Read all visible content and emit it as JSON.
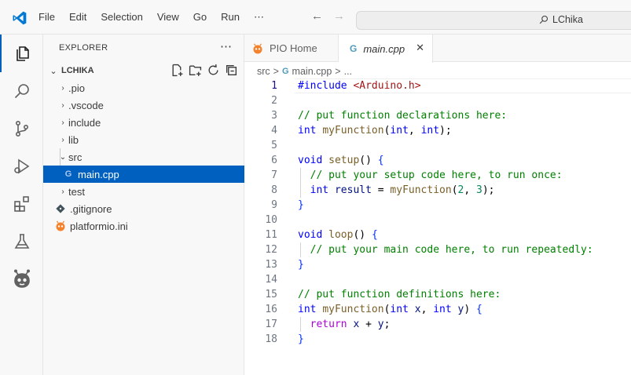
{
  "titlebar": {
    "menu": [
      "File",
      "Edit",
      "Selection",
      "View",
      "Go",
      "Run",
      "⋯"
    ],
    "search_text": "LChika"
  },
  "activity_bar": {
    "items": [
      "explorer-icon",
      "search-icon",
      "source-control-icon",
      "run-debug-icon",
      "extensions-icon",
      "testing-icon",
      "platformio-icon"
    ],
    "active": "explorer-icon"
  },
  "sidebar": {
    "header": "EXPLORER",
    "more": "⋯",
    "section_title": "LCHIKA",
    "tree": [
      {
        "label": ".pio",
        "type": "folder",
        "expanded": false
      },
      {
        "label": ".vscode",
        "type": "folder",
        "expanded": false
      },
      {
        "label": "include",
        "type": "folder",
        "expanded": false
      },
      {
        "label": "lib",
        "type": "folder",
        "expanded": false
      },
      {
        "label": "src",
        "type": "folder",
        "expanded": true
      },
      {
        "label": "main.cpp",
        "type": "cpp-file",
        "selected": true
      },
      {
        "label": "test",
        "type": "folder",
        "expanded": false
      },
      {
        "label": ".gitignore",
        "type": "git-file"
      },
      {
        "label": "platformio.ini",
        "type": "platformio-file"
      }
    ]
  },
  "tabs": [
    {
      "label": "PIO Home",
      "active": false
    },
    {
      "label": "main.cpp",
      "active": true,
      "close": "✕"
    }
  ],
  "breadcrumb": {
    "folder": "src",
    "sep": ">",
    "file": "main.cpp",
    "rest": "..."
  },
  "editor": {
    "current_line": 1,
    "lines": [
      {
        "n": "1",
        "tokens": [
          [
            "#include",
            "kw"
          ],
          [
            " ",
            "txt"
          ],
          [
            "<Arduino.h>",
            "str"
          ]
        ]
      },
      {
        "n": "2",
        "tokens": []
      },
      {
        "n": "3",
        "tokens": [
          [
            "// put function declarations here:",
            "cm"
          ]
        ]
      },
      {
        "n": "4",
        "tokens": [
          [
            "int",
            "kw"
          ],
          [
            " ",
            "txt"
          ],
          [
            "myFunction",
            "fn"
          ],
          [
            "(",
            "txt"
          ],
          [
            "int",
            "kw"
          ],
          [
            ", ",
            "txt"
          ],
          [
            "int",
            "kw"
          ],
          [
            ");",
            "txt"
          ]
        ]
      },
      {
        "n": "5",
        "tokens": []
      },
      {
        "n": "6",
        "tokens": [
          [
            "void",
            "kw"
          ],
          [
            " ",
            "txt"
          ],
          [
            "setup",
            "fn"
          ],
          [
            "()",
            "txt"
          ],
          [
            " ",
            "txt"
          ],
          [
            "{",
            "br1"
          ]
        ]
      },
      {
        "n": "7",
        "tokens": [
          [
            "  ",
            "txt"
          ],
          [
            "// put your setup code here, to run once:",
            "cm"
          ]
        ]
      },
      {
        "n": "8",
        "tokens": [
          [
            "  ",
            "txt"
          ],
          [
            "int",
            "kw"
          ],
          [
            " ",
            "txt"
          ],
          [
            "result",
            "param"
          ],
          [
            " = ",
            "txt"
          ],
          [
            "myFunction",
            "fn"
          ],
          [
            "(",
            "txt"
          ],
          [
            "2",
            "num"
          ],
          [
            ", ",
            "txt"
          ],
          [
            "3",
            "num"
          ],
          [
            ");",
            "txt"
          ]
        ]
      },
      {
        "n": "9",
        "tokens": [
          [
            "}",
            "br1"
          ]
        ]
      },
      {
        "n": "10",
        "tokens": []
      },
      {
        "n": "11",
        "tokens": [
          [
            "void",
            "kw"
          ],
          [
            " ",
            "txt"
          ],
          [
            "loop",
            "fn"
          ],
          [
            "()",
            "txt"
          ],
          [
            " ",
            "txt"
          ],
          [
            "{",
            "br1"
          ]
        ]
      },
      {
        "n": "12",
        "tokens": [
          [
            "  ",
            "txt"
          ],
          [
            "// put your main code here, to run repeatedly:",
            "cm"
          ]
        ]
      },
      {
        "n": "13",
        "tokens": [
          [
            "}",
            "br1"
          ]
        ]
      },
      {
        "n": "14",
        "tokens": []
      },
      {
        "n": "15",
        "tokens": [
          [
            "// put function definitions here:",
            "cm"
          ]
        ]
      },
      {
        "n": "16",
        "tokens": [
          [
            "int",
            "kw"
          ],
          [
            " ",
            "txt"
          ],
          [
            "myFunction",
            "fn"
          ],
          [
            "(",
            "txt"
          ],
          [
            "int",
            "kw"
          ],
          [
            " ",
            "txt"
          ],
          [
            "x",
            "param"
          ],
          [
            ", ",
            "txt"
          ],
          [
            "int",
            "kw"
          ],
          [
            " ",
            "txt"
          ],
          [
            "y",
            "param"
          ],
          [
            ")",
            "txt"
          ],
          [
            " ",
            "txt"
          ],
          [
            "{",
            "br1"
          ]
        ]
      },
      {
        "n": "17",
        "tokens": [
          [
            "  ",
            "txt"
          ],
          [
            "return",
            "ctl"
          ],
          [
            " ",
            "txt"
          ],
          [
            "x",
            "param"
          ],
          [
            " + ",
            "txt"
          ],
          [
            "y",
            "param"
          ],
          [
            ";",
            "txt"
          ]
        ]
      },
      {
        "n": "18",
        "tokens": [
          [
            "}",
            "br1"
          ]
        ]
      }
    ]
  },
  "colors": {
    "accent": "#005fb8",
    "selection": "#0060c0",
    "keyword": "#0000ff",
    "control": "#af00db",
    "function": "#795e26",
    "comment": "#008000",
    "string": "#a31515",
    "number": "#098658",
    "platformio": "#f5822a"
  }
}
